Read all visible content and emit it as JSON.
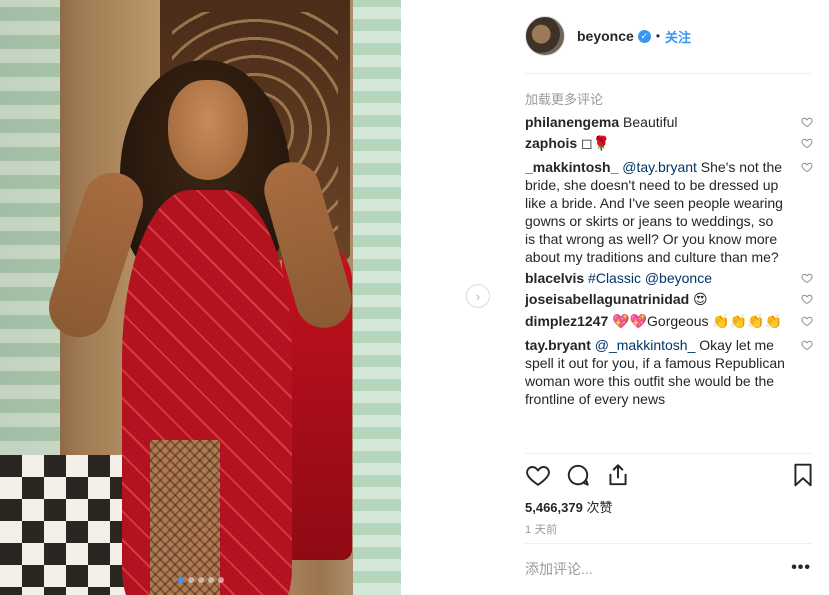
{
  "post": {
    "username": "beyonce",
    "follow_label": "关注",
    "separator": "•",
    "verified_mark": "✓"
  },
  "carousel": {
    "total": 5,
    "active_index": 0,
    "accent": "#3897f0",
    "next_glyph": "›"
  },
  "comments_section": {
    "load_more": "加载更多评论",
    "items": [
      {
        "user": "philanengema",
        "parts": [
          {
            "text": " Beautiful"
          }
        ]
      },
      {
        "user": "zaphois",
        "parts": [
          {
            "text": " ◻🌹"
          }
        ]
      },
      {
        "user": "_makkintosh_",
        "parts": [
          {
            "text": " "
          },
          {
            "text": "@tay.bryant",
            "mention": true
          },
          {
            "text": " She's not the bride, she doesn't need to be dressed up like a bride. And I've seen people wearing gowns or skirts or jeans to weddings, so is that wrong as well? Or you know more about my traditions and culture than me?"
          }
        ]
      },
      {
        "user": "blacelvis",
        "parts": [
          {
            "text": " "
          },
          {
            "text": "#Classic",
            "mention": true
          },
          {
            "text": " "
          },
          {
            "text": "@beyonce",
            "mention": true
          }
        ]
      },
      {
        "user": "joseisabellagunatrinidad",
        "parts": [
          {
            "text": " 😍"
          }
        ]
      },
      {
        "user": "dimplez1247",
        "parts": [
          {
            "text": " 💖💖Gorgeous 👏👏👏👏"
          }
        ]
      },
      {
        "user": "tay.bryant",
        "parts": [
          {
            "text": " "
          },
          {
            "text": "@_makkintosh_",
            "mention": true
          },
          {
            "text": " Okay let me spell it out for you, if a famous Republican woman wore this outfit she would be the frontline of every news"
          }
        ]
      }
    ]
  },
  "actions": {
    "like_icon": "heart-icon",
    "comment_icon": "comment-icon",
    "share_icon": "share-icon",
    "save_icon": "bookmark-icon"
  },
  "likes": {
    "count": "5,466,379",
    "unit": "次赞"
  },
  "timestamp": "1 天前",
  "add_comment": {
    "placeholder": "添加评论..."
  },
  "more_options": "•••",
  "colors": {
    "link": "#003569",
    "brand_blue": "#3897f0",
    "muted": "#999999",
    "text": "#262626"
  }
}
